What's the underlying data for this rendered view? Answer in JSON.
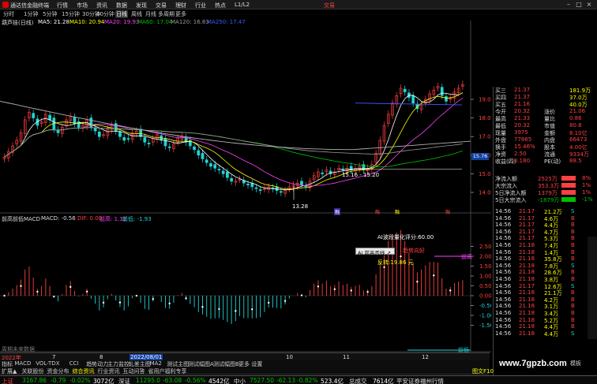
{
  "colors": {
    "up": "#ff4040",
    "down": "#22d3d3",
    "yellow": "#ffff00",
    "white": "#ffffff",
    "green": "#00c000",
    "magenta": "#ff40ff",
    "purple": "#b070ff",
    "grey": "#9a9a9a",
    "orange": "#ff9900"
  },
  "titlebar": {
    "app_title": "通达信金融终端",
    "menus": [
      "行情",
      "市场",
      "资讯",
      "数据",
      "发现",
      "交易",
      "理财",
      "行业",
      "热点",
      "L1/L2"
    ],
    "trade_label": "交易"
  },
  "periods": [
    "分时",
    "1分钟",
    "5分钟",
    "15分钟",
    "30分钟",
    "60分钟",
    "日线",
    "周线",
    "月线",
    "多周期",
    "更多"
  ],
  "stock_line": "葫芦娃(日线)",
  "ma_legend": [
    {
      "label": "MA5: 21.28",
      "color": "#ffffff"
    },
    {
      "label": "MA10: 20.94",
      "color": "#ffff00"
    },
    {
      "label": "MA20: 19.93",
      "color": "#ff40ff"
    },
    {
      "label": "MA60: 17.04",
      "color": "#00c000"
    },
    {
      "label": "MA120: 16.83",
      "color": "#9a9a9a"
    },
    {
      "label": "MA250: 17.47",
      "color": "#3a5cff"
    }
  ],
  "chart_data": {
    "type": "candlestick",
    "price_axis": [
      19.0,
      18.0,
      17.0,
      16.0,
      15.0,
      14.0
    ],
    "price_axis_extra": "15.76",
    "low_label": "13.28",
    "range_label": "15.16 - 15.20",
    "event_markers": [
      "融",
      "融",
      "融",
      "融"
    ],
    "macd_axis": [
      2.5,
      2.0,
      1.5,
      1.0,
      0.5,
      0.0,
      -0.5,
      -1.0,
      -1.5
    ],
    "date_labels": [
      "2022年",
      "7",
      "8",
      "2022/08/01",
      "10",
      "11",
      "12"
    ]
  },
  "indicator": {
    "title": "前高前低MACD",
    "macd": "MACD: -0.56",
    "dif": "DIF: 0.00",
    "prev_high": "前高: 1.32",
    "prev_low": "前低: -1.93",
    "score": "AI波段量化评分:60.00",
    "trend": "趋势向好",
    "callout": "AI 前高否线 ↗",
    "support": "反转:19.86 元",
    "tag_high": "前高",
    "tag_low": "前低",
    "bottom_text": "周期未来数据"
  },
  "quote": {
    "rows": [
      {
        "l": "买三",
        "v": "21.37",
        "r": "181.9万"
      },
      {
        "l": "买四",
        "v": "21.37",
        "r": "37.0万"
      },
      {
        "l": "买五",
        "v": "21.16",
        "r": "40.0万"
      },
      {
        "l": "今开",
        "v": "20.32",
        "l2": "涨价",
        "v2": "21.06"
      },
      {
        "l": "最高",
        "v": "21.33",
        "l2": "量比",
        "v2": "0.86"
      },
      {
        "l": "最低",
        "v": "20.32",
        "l2": "市值",
        "v2": "80.8"
      },
      {
        "l": "现量",
        "v": "3975",
        "l2": "金额",
        "v2": "8.10亿"
      },
      {
        "l": "外盘",
        "v": "77865",
        "l2": "内盘",
        "v2": "66473"
      },
      {
        "l": "换手",
        "v": "15.46%",
        "l2": "股本",
        "v2": "4.00亿"
      },
      {
        "l": "净资",
        "v": "2.50",
        "l2": "流通",
        "v2": "9334万"
      },
      {
        "l": "收益(四)",
        "v": "0.180",
        "l2": "PE(动)",
        "v2": "88.5"
      }
    ],
    "flows": [
      {
        "l": "净流入额",
        "v": "2525万",
        "p": "8%",
        "c": "#ff4040"
      },
      {
        "l": "大宗流入",
        "v": "353.3万",
        "p": "1%",
        "c": "#ff4040"
      },
      {
        "l": "5日净流入额",
        "v": "1379万",
        "p": "1%",
        "c": "#ff4040"
      },
      {
        "l": "5日大宗流入",
        "v": "-1879万",
        "p": "-1%",
        "c": "#00c000"
      }
    ],
    "ticks": [
      {
        "t": "14:56",
        "p": "21.17",
        "v": "21.2万",
        "d": "S"
      },
      {
        "t": "14:56",
        "p": "21.17",
        "v": "4.6万",
        "d": "B"
      },
      {
        "t": "14:56",
        "p": "21.17",
        "v": "4.4万",
        "d": "B"
      },
      {
        "t": "14:56",
        "p": "21.17",
        "v": "4.7万",
        "d": "B"
      },
      {
        "t": "14:56",
        "p": "21.17",
        "v": "5.3万",
        "d": "B"
      },
      {
        "t": "14:56",
        "p": "21.18",
        "v": "7.4万",
        "d": "B"
      },
      {
        "t": "14:56",
        "p": "21.18",
        "v": "1.4万",
        "d": "B"
      },
      {
        "t": "14:56",
        "p": "21.18",
        "v": "35.8万",
        "d": "B"
      },
      {
        "t": "14:56",
        "p": "21.18",
        "v": "7.8万",
        "d": "S"
      },
      {
        "t": "14:56",
        "p": "21.18",
        "v": "28.6万",
        "d": "B"
      },
      {
        "t": "14:56",
        "p": "21.18",
        "v": "3.8万",
        "d": "B"
      },
      {
        "t": "14:56",
        "p": "21.17",
        "v": "12.6万",
        "d": "S"
      },
      {
        "t": "14:56",
        "p": "21.18",
        "v": "21.1万",
        "d": "B"
      },
      {
        "t": "14:56",
        "p": "21.18",
        "v": "4.2万",
        "d": "B"
      },
      {
        "t": "14:56",
        "p": "21.18",
        "v": "3.1万",
        "d": "B"
      },
      {
        "t": "14:56",
        "p": "21.18",
        "v": "3.4万",
        "d": "B"
      },
      {
        "t": "14:56",
        "p": "21.18",
        "v": "5.2万",
        "d": "B"
      },
      {
        "t": "14:56",
        "p": "21.18",
        "v": "4.4万",
        "d": "B"
      },
      {
        "t": "14:56",
        "p": "21.18",
        "v": "4.4万",
        "d": "S"
      }
    ]
  },
  "bottombar": {
    "year": "2022年",
    "dates": [
      "7",
      "8",
      "2022/08/01",
      "10",
      "11",
      "12"
    ]
  },
  "tabs2": [
    "指标",
    "MACD",
    "VOL-TDX",
    "CCI",
    "趋势动力",
    "主力监控",
    "轧差主图",
    "MA2",
    "测试主图",
    "测试幅图A",
    "测试幅图B",
    "更多",
    "设置"
  ],
  "tabs3": [
    "扩展▲",
    "关联股份",
    "资金分布",
    "综合资讯",
    "行业资讯",
    "互动问答",
    "省用户福利专享"
  ],
  "status": {
    "sh_name": "上证",
    "sh_val": "3167.86",
    "sh_chg": "-0.79",
    "sh_pct": "-0.02%",
    "sh_amt": "3072亿",
    "sz_name": "深证",
    "sz_val": "11295.0",
    "sz_chg": "-63.08",
    "sz_pct": "-0.56%",
    "sz_amt": "4542亿",
    "zx_name": "中小",
    "zx_val": "7527.50",
    "zx_chg": "-62.13",
    "zx_pct": "-0.82%",
    "zx_amt": "523.4亿",
    "total_label": "总成交",
    "total_val": "7614亿",
    "broker": "平安证券福州行情"
  },
  "watermark": "www.7gpzb.com",
  "side_label": "图文F10",
  "right_side_label": "模板"
}
